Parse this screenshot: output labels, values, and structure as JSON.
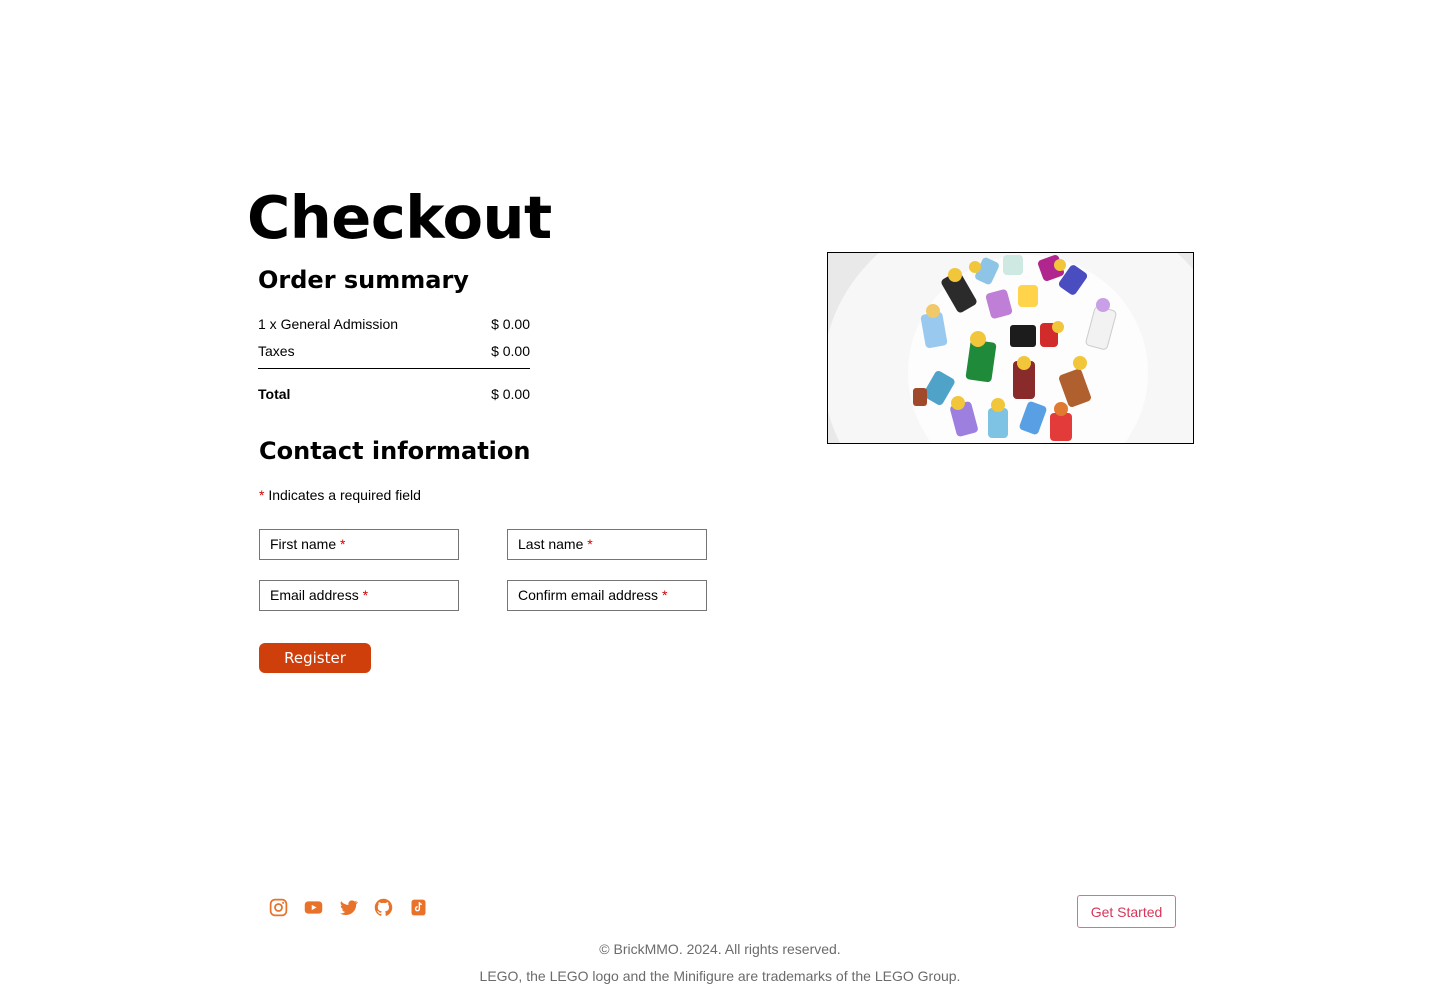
{
  "page": {
    "title": "Checkout"
  },
  "order_summary": {
    "heading": "Order summary",
    "items": [
      {
        "label": "1 x General Admission",
        "value": "$ 0.00"
      },
      {
        "label": "Taxes",
        "value": "$ 0.00"
      }
    ],
    "total": {
      "label": "Total",
      "value": "$ 0.00"
    }
  },
  "contact": {
    "heading": "Contact information",
    "required_star": "*",
    "required_note": "Indicates a required field",
    "fields": {
      "first_name": "First name",
      "last_name": "Last name",
      "email": "Email address",
      "confirm_email": "Confirm email address"
    },
    "register_label": "Register"
  },
  "hero_image": {
    "description_icon": "lego-minifigures-photo"
  },
  "footer": {
    "social_icons": [
      "instagram-icon",
      "youtube-icon",
      "twitter-icon",
      "github-icon",
      "tiktok-icon"
    ],
    "social_color": "#e8722a",
    "get_started_label": "Get Started",
    "copyright": "© BrickMMO. 2024. All rights reserved.",
    "trademark": "LEGO, the LEGO logo and the Minifigure are trademarks of the LEGO Group."
  },
  "colors": {
    "accent": "#cf3f0c",
    "required": "#d40000",
    "get_started": "#d7365a"
  }
}
